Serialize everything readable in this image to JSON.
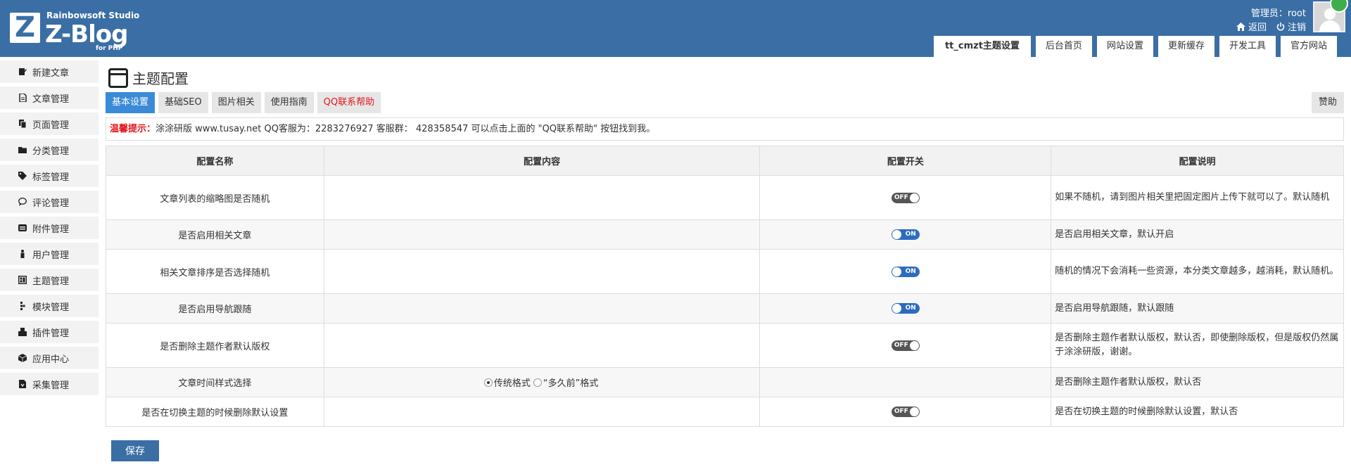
{
  "brand": {
    "logo_letter": "Z",
    "studio": "Rainbowsoft Studio",
    "name": "Z-Blog",
    "sub": "for PHP"
  },
  "header": {
    "admin": "管理员：root",
    "back": "返回",
    "logout": "注销",
    "tabs": [
      "tt_cmzt主题设置",
      "后台首页",
      "网站设置",
      "更新缓存",
      "开发工具",
      "官方网站"
    ]
  },
  "sidebar": {
    "items": [
      {
        "label": "新建文章",
        "icon": "pen-icon"
      },
      {
        "label": "文章管理",
        "icon": "document-icon"
      },
      {
        "label": "页面管理",
        "icon": "pages-icon"
      },
      {
        "label": "分类管理",
        "icon": "folder-icon"
      },
      {
        "label": "标签管理",
        "icon": "tag-icon"
      },
      {
        "label": "评论管理",
        "icon": "comment-icon"
      },
      {
        "label": "附件管理",
        "icon": "attachment-icon"
      },
      {
        "label": "用户管理",
        "icon": "user-icon"
      },
      {
        "label": "主题管理",
        "icon": "theme-icon"
      },
      {
        "label": "模块管理",
        "icon": "module-icon"
      },
      {
        "label": "插件管理",
        "icon": "plugin-icon"
      },
      {
        "label": "应用中心",
        "icon": "box-icon"
      },
      {
        "label": "采集管理",
        "icon": "collect-icon"
      }
    ]
  },
  "main": {
    "title": "主题配置",
    "tabs": [
      "基本设置",
      "基础SEO",
      "图片相关",
      "使用指南",
      "QQ联系帮助"
    ],
    "donate": "赞助",
    "notice_label": "温馨提示：",
    "notice_text": "涂涂研版 www.tusay.net QQ客服为：2283276927 客服群： 428358547 可以点击上面的 \"QQ联系帮助\" 按钮找到我。",
    "table": {
      "headers": [
        "配置名称",
        "配置内容",
        "配置开关",
        "配置说明"
      ],
      "rows": [
        {
          "name": "文章列表的缩略图是否随机",
          "switch": "OFF",
          "desc": "如果不随机，请到图片相关里把固定图片上传下就可以了。默认随机"
        },
        {
          "name": "是否启用相关文章",
          "switch": "ON",
          "desc": "是否启用相关文章，默认开启"
        },
        {
          "name": "相关文章排序是否选择随机",
          "switch": "ON",
          "desc": "随机的情况下会消耗一些资源，本分类文章越多，越消耗，默认随机。"
        },
        {
          "name": "是否启用导航跟随",
          "switch": "ON",
          "desc": "是否启用导航跟随，默认跟随"
        },
        {
          "name": "是否删除主题作者默认版权",
          "switch": "OFF",
          "desc": "是否删除主题作者默认版权，默认否，即使删除版权，但是版权仍然属于涂涂研版，谢谢。"
        },
        {
          "name": "文章时间样式选择",
          "switch": "",
          "desc": "是否删除主题作者默认版权，默认否",
          "radio": [
            "传统格式",
            "“多久前”格式"
          ]
        },
        {
          "name": "是否在切换主题的时候删除默认设置",
          "switch": "OFF",
          "desc": "是否在切换主题的时候删除默认设置，默认否"
        }
      ]
    },
    "save": "保存"
  }
}
